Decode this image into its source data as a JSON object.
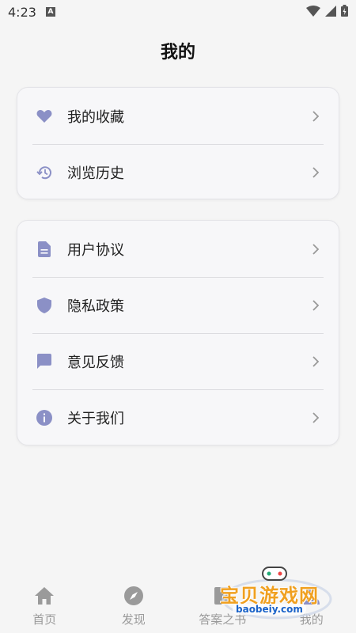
{
  "status_bar": {
    "time": "4:23",
    "badge": "A"
  },
  "header": {
    "title": "我的"
  },
  "accent_color": "#8b90c6",
  "group1": [
    {
      "label": "我的收藏",
      "icon": "heart-icon"
    },
    {
      "label": "浏览历史",
      "icon": "history-icon"
    }
  ],
  "group2": [
    {
      "label": "用户协议",
      "icon": "document-icon"
    },
    {
      "label": "隐私政策",
      "icon": "shield-icon"
    },
    {
      "label": "意见反馈",
      "icon": "feedback-icon"
    },
    {
      "label": "关于我们",
      "icon": "info-icon"
    }
  ],
  "tabs": [
    {
      "label": "首页",
      "icon": "home-icon"
    },
    {
      "label": "发现",
      "icon": "compass-icon"
    },
    {
      "label": "答案之书",
      "icon": "book-icon"
    },
    {
      "label": "我的",
      "icon": "person-icon"
    }
  ],
  "watermark": {
    "text": "宝贝游戏网",
    "sub": "baobeiy.com"
  }
}
